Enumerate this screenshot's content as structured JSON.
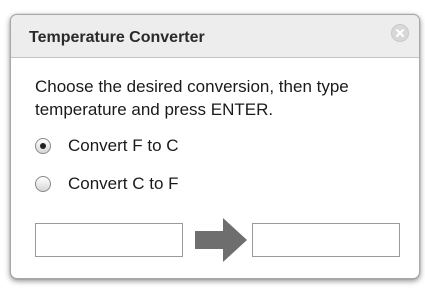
{
  "window": {
    "title": "Temperature Converter"
  },
  "instructions": "Choose the desired conversion, then type temperature and press ENTER.",
  "options": [
    {
      "label": "Convert F to C",
      "checked": true
    },
    {
      "label": "Convert C to F",
      "checked": false
    }
  ],
  "input": {
    "value": "",
    "placeholder": ""
  },
  "output": {
    "value": "",
    "placeholder": ""
  },
  "icons": {
    "close": "close-icon",
    "arrow": "arrow-right-icon"
  },
  "colors": {
    "arrow": "#6e6e6e",
    "titlebar": "#ededed"
  }
}
